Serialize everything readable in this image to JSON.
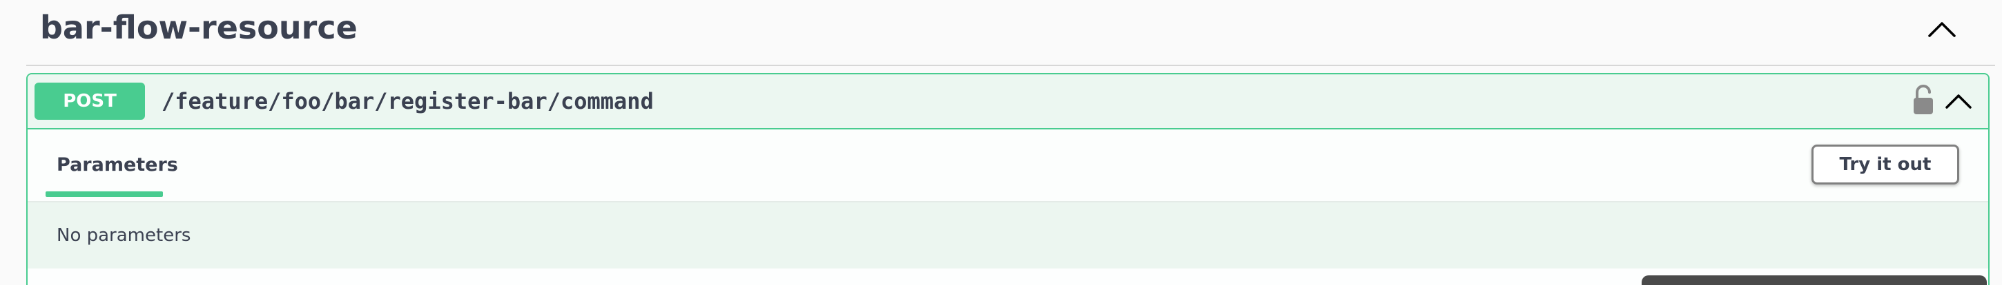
{
  "tag": {
    "title": "bar-flow-resource",
    "toggle_icon": "chevron-up-icon"
  },
  "operation": {
    "method": "POST",
    "path": "/feature/foo/bar/register-bar/command",
    "lock_icon": "lock-open-icon",
    "collapse_icon": "chevron-up-icon",
    "accent_color": "#49cc90"
  },
  "tabs": [
    {
      "label": "Parameters",
      "active": true
    }
  ],
  "actions": {
    "try_it_out_label": "Try it out"
  },
  "parameters": {
    "empty_text": "No parameters"
  }
}
